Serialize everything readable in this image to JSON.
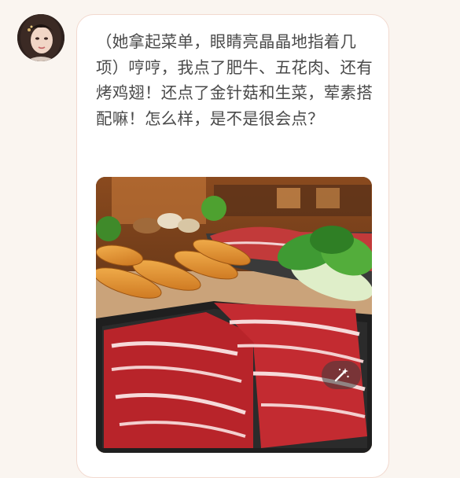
{
  "message": {
    "text": "（她拿起菜单，眼睛亮晶晶地指着几项）哼哼，我点了肥牛、五花肉、还有烤鸡翅！还点了金针菇和生菜，荤素搭配嘛！怎么样，是不是很会点？"
  },
  "image_action": {
    "icon": "magic-wand-icon"
  },
  "colors": {
    "background": "#faf5f0",
    "bubble": "#ffffff",
    "bubble_border": "#f2d9cf",
    "text": "#4a4a4a"
  }
}
